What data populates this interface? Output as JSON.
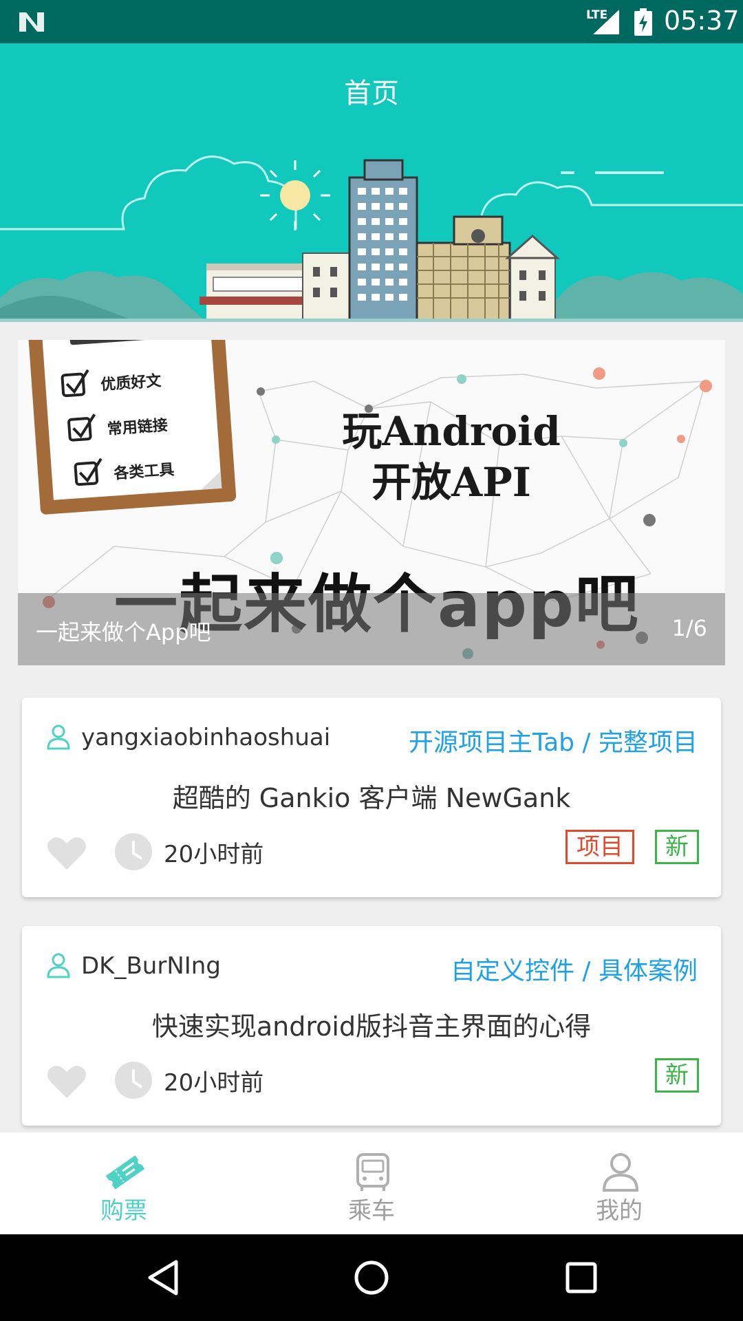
{
  "status_bar": {
    "network": "LTE",
    "time": "05:37"
  },
  "header": {
    "title": "首页"
  },
  "banner": {
    "title_line1": "玩Android",
    "title_line2": "开放API",
    "slogan": "一起来做个app吧",
    "checklist": [
      "优质好文",
      "常用链接",
      "各类工具"
    ],
    "caption": "一起来做个App吧",
    "indicator": "1/6"
  },
  "articles": [
    {
      "author": "yangxiaobinhaoshuai",
      "category": "开源项目主Tab / 完整项目",
      "title": "超酷的 Gankio 客户端 NewGank",
      "time": "20小时前",
      "tags": [
        "项目",
        "新"
      ]
    },
    {
      "author": "DK_BurNIng",
      "category": "自定义控件 / 具体案例",
      "title": "快速实现android版抖音主界面的心得",
      "time": "20小时前",
      "tags": [
        "新"
      ]
    }
  ],
  "tabs": [
    {
      "label": "购票",
      "icon": "ticket-icon",
      "active": true
    },
    {
      "label": "乘车",
      "icon": "bus-icon",
      "active": false
    },
    {
      "label": "我的",
      "icon": "person-icon",
      "active": false
    }
  ],
  "colors": {
    "primary": "#11c8bc",
    "status_bar": "#00695f",
    "tab_active": "#4fd1c5",
    "category_link": "#1da1e8",
    "tag_project": "#e04a2b",
    "tag_new": "#3bb54a"
  }
}
